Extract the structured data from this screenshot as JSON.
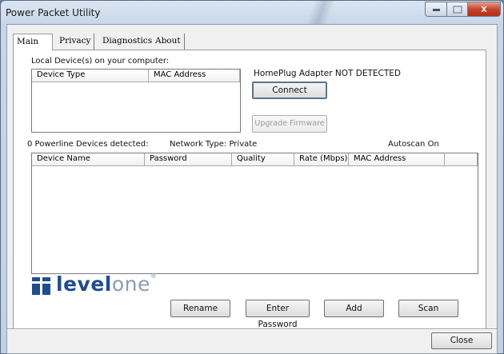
{
  "window": {
    "title": "Power Packet Utility",
    "close_glyph": "x"
  },
  "tabs": [
    {
      "label": "Main"
    },
    {
      "label": "Privacy"
    },
    {
      "label": "Diagnostics"
    },
    {
      "label": "About"
    }
  ],
  "local": {
    "heading": "Local Device(s) on your computer:",
    "columns": [
      "Device Type",
      "MAC Address"
    ],
    "rows": []
  },
  "adapter": {
    "status": "HomePlug Adapter NOT DETECTED",
    "connect_label": "Connect",
    "upgrade_label": "Upgrade Firmware"
  },
  "powerline": {
    "detected": "0 Powerline Devices detected:",
    "network_type": "Network Type: Private",
    "autoscan": "Autoscan On",
    "columns": [
      "Device Name",
      "Password",
      "Quality",
      "Rate (Mbps)",
      "MAC Address"
    ],
    "rows": []
  },
  "logo": {
    "part1": "level",
    "part2": "one",
    "tm": "®"
  },
  "actions": {
    "rename": "Rename",
    "enter_password": "Enter Password",
    "add": "Add",
    "scan": "Scan"
  },
  "footer": {
    "close": "Close"
  },
  "colors": {
    "brand": "#1f4d8f",
    "title_close": "#c5452a"
  },
  "icons": [
    "minimize-icon",
    "maximize-icon",
    "close-icon",
    "levelone-logo-icon"
  ]
}
